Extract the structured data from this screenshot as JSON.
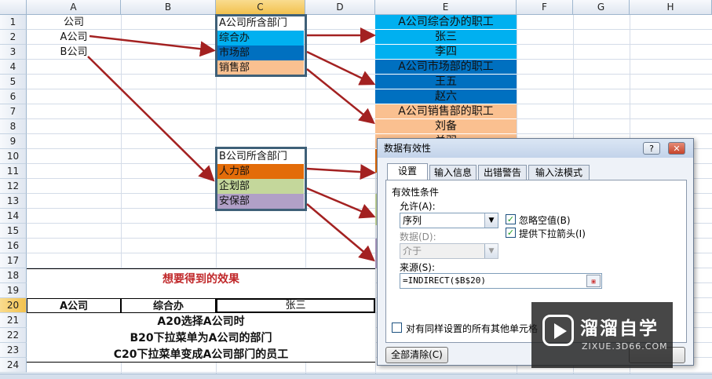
{
  "sheet": {
    "columns": [
      "A",
      "B",
      "C",
      "D",
      "E",
      "F",
      "G",
      "H"
    ],
    "rows": [
      "1",
      "2",
      "3",
      "4",
      "5",
      "6",
      "7",
      "8",
      "9",
      "10",
      "11",
      "12",
      "13",
      "14",
      "15",
      "16",
      "17",
      "18",
      "19",
      "20",
      "21",
      "22",
      "23",
      "24"
    ],
    "a1": "公司",
    "a2": "A公司",
    "a3": "B公司",
    "c_box1": {
      "header": "A公司所含部门",
      "items": [
        "综合办",
        "市场部",
        "销售部"
      ]
    },
    "c_box2": {
      "header": "B公司所含部门",
      "items": [
        "人力部",
        "企划部",
        "安保部"
      ]
    },
    "e_col": [
      "A公司综合办的职工",
      "张三",
      "李四",
      "A公司市场部的职工",
      "王五",
      "赵六",
      "A公司销售部的职工",
      "刘备",
      "关羽"
    ],
    "result_title": "想要得到的效果",
    "row20": [
      "A公司",
      "综合办",
      "张三"
    ],
    "notes": [
      "A20选择A公司时",
      "B20下拉菜单为A公司的部门",
      "C20下拉菜单变成A公司部门的员工"
    ]
  },
  "dialog": {
    "title": "数据有效性",
    "help_btn": "?",
    "close_btn": "✕",
    "tabs": [
      "设置",
      "输入信息",
      "出错警告",
      "输入法模式"
    ],
    "section": "有效性条件",
    "allow_label": "允许(A):",
    "allow_value": "序列",
    "data_label": "数据(D):",
    "data_value": "介于",
    "ignore_blank": "忽略空值(B)",
    "dropdown": "提供下拉箭头(I)",
    "source_label": "来源(S):",
    "source_value": "=INDIRECT($B$20)",
    "apply_all": "对有同样设置的所有其他单元格",
    "clear_all": "全部清除(C)"
  },
  "watermark": {
    "brand": "溜溜自学",
    "url": "ZIXUE.3D66.COM"
  },
  "colors": {
    "arrow": "#a32121",
    "box_border": "#3f6078",
    "result_title": "#c0282a"
  }
}
